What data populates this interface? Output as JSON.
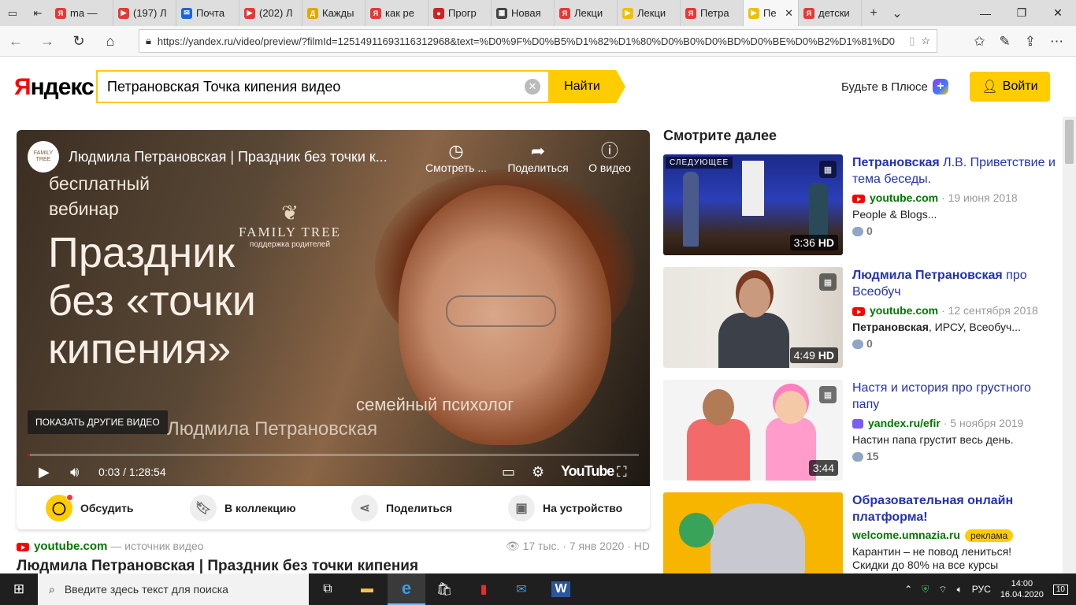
{
  "browser": {
    "tabs": [
      {
        "label": "ma —",
        "favicon": "Я",
        "color": "#e53935"
      },
      {
        "label": "(197) Л",
        "favicon": "▶",
        "color": "#e53935"
      },
      {
        "label": "Почта",
        "favicon": "✉",
        "color": "#1e66d8"
      },
      {
        "label": "(202) Л",
        "favicon": "▶",
        "color": "#e53935"
      },
      {
        "label": "Кажды",
        "favicon": "Д",
        "color": "#e0a800"
      },
      {
        "label": "как ре",
        "favicon": "Я",
        "color": "#e53935"
      },
      {
        "label": "Прогр",
        "favicon": "●",
        "color": "#cc2222"
      },
      {
        "label": "Новая",
        "favicon": "▦",
        "color": "#444444"
      },
      {
        "label": "Лекци",
        "favicon": "Я",
        "color": "#e53935"
      },
      {
        "label": "Лекци",
        "favicon": "▶",
        "color": "#f0c000"
      },
      {
        "label": "Петра",
        "favicon": "Я",
        "color": "#e53935"
      },
      {
        "label": "Пе",
        "favicon": "▶",
        "color": "#f0c000",
        "active": true
      },
      {
        "label": "детски",
        "favicon": "Я",
        "color": "#e53935"
      }
    ],
    "url": "https://yandex.ru/video/preview/?filmId=12514911693116312968&text=%D0%9F%D0%B5%D1%82%D1%80%D0%B0%D0%BD%D0%BE%D0%B2%D1%81%D0"
  },
  "header": {
    "logo_ya": "Я",
    "logo_rest": "ндекс",
    "search_value": "Петрановская Точка кипения видео",
    "find_label": "Найти",
    "plus_label": "Будьте в Плюсе",
    "login_label": "Войти"
  },
  "player": {
    "title": "Людмила Петрановская | Праздник без точки к...",
    "watch_later": "Смотреть ...",
    "share": "Поделиться",
    "about": "О видео",
    "poster_small1": "бесплатный",
    "poster_small2": "вебинар",
    "brand1": "FAMILY TREE",
    "brand2": "поддержка родителей",
    "poster_line1": "Праздник",
    "poster_line2": "без «точки",
    "poster_line3": "кипения»",
    "poster_sub": "семейный психолог",
    "poster_name": "Людмила Петрановская",
    "show_more": "ПОКАЗАТЬ ДРУГИЕ ВИДЕО",
    "time": "0:03 / 1:28:54",
    "progress_fraction": 0.0006,
    "yt_label": "YouTube"
  },
  "actions": {
    "discuss": "Обсудить",
    "collection": "В коллекцию",
    "share": "Поделиться",
    "device": "На устройство"
  },
  "source": {
    "domain": "youtube.com",
    "suffix": "— источник видео",
    "views": "17 тыс.",
    "date": "7 янв 2020",
    "quality": "HD",
    "title": "Людмила Петрановская | Праздник без точки кипения"
  },
  "sidebar": {
    "heading": "Смотрите далее",
    "cards": [
      {
        "title_bold": "Петрановская",
        "title_rest": " Л.В. Приветствие и тема беседы.",
        "domain": "youtube.com",
        "date": "19 июня 2018",
        "desc": "People & Blogs...",
        "comments": "0",
        "duration": "3:36",
        "hd": "HD",
        "next": "СЛЕДУЮЩЕЕ"
      },
      {
        "title_bold": "Людмила Петрановская",
        "title_rest": " про Всеобуч",
        "domain": "youtube.com",
        "date": "12 сентября 2018",
        "desc_bold": "Петрановская",
        "desc": ", ИРСУ, Всеобуч...",
        "comments": "0",
        "duration": "4:49",
        "hd": "HD"
      },
      {
        "title_bold": "",
        "title_rest": "Настя и история про грустного папу",
        "domain": "yandex.ru/efir",
        "date": "5 ноября 2019",
        "desc": "Настин папа грустит весь день.",
        "comments": "15",
        "duration": "3:44"
      },
      {
        "title_bold": "Образовательная онлайн платформа!",
        "title_rest": "",
        "domain": "welcome.umnazia.ru",
        "ad": "реклама",
        "desc": "Карантин – не повод лениться!",
        "desc2": "Скидки до 80% на все курсы"
      }
    ]
  },
  "taskbar": {
    "search_placeholder": "Введите здесь текст для поиска",
    "lang": "РУС",
    "time": "14:00",
    "date": "16.04.2020",
    "notif": "10"
  },
  "colors": {
    "accent": "#ffcc00",
    "link": "#2331b4",
    "green": "#007700",
    "red": "#ff0000"
  }
}
